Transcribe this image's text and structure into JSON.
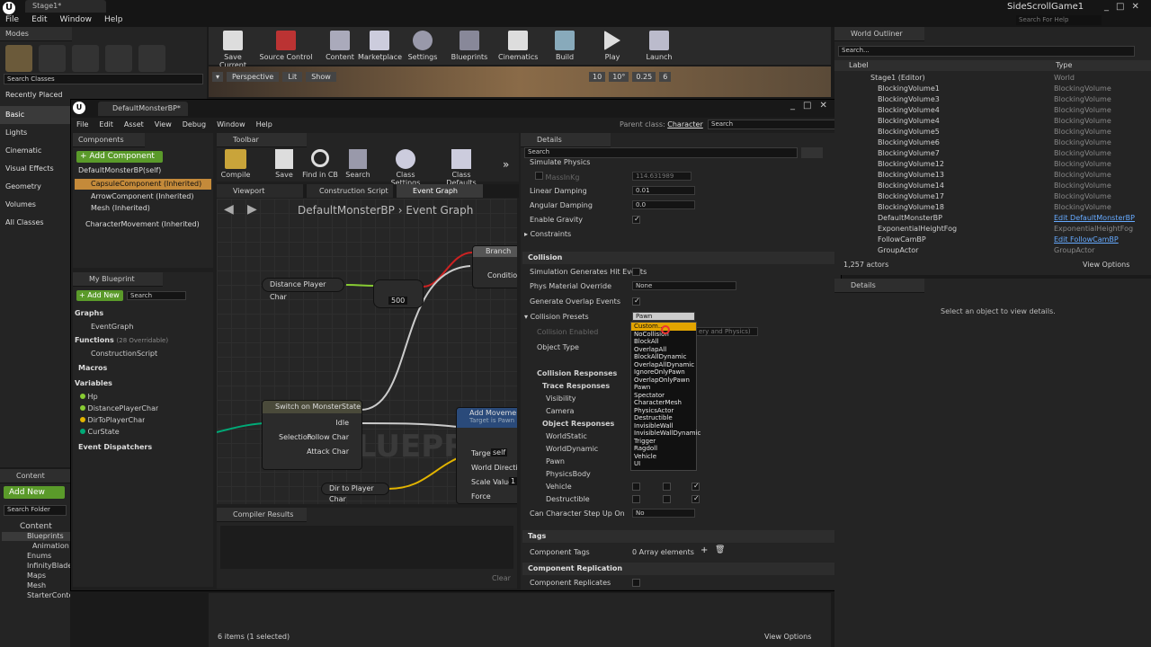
{
  "menubar": {
    "items": [
      "File",
      "Edit",
      "Window",
      "Help"
    ],
    "tab": "Stage1*",
    "project": "SideScrollGame1",
    "search_placeholder": "Search For Help"
  },
  "modes": {
    "title": "Modes",
    "search": "Search Classes",
    "categories": [
      "Recently Placed",
      "Basic",
      "Lights",
      "Cinematic",
      "Visual Effects",
      "Geometry",
      "Volumes",
      "All Classes"
    ]
  },
  "toolbar": {
    "buttons": [
      "Save Current",
      "Source Control",
      "Content",
      "Marketplace",
      "Settings",
      "Blueprints",
      "Cinematics",
      "Build",
      "Play",
      "Launch"
    ]
  },
  "viewport": {
    "perspective": "Perspective",
    "lit": "Lit",
    "show": "Show",
    "grid": "10",
    "angle": "10°",
    "scale": "0.25",
    "cams": "6"
  },
  "bp": {
    "tab": "DefaultMonsterBP*",
    "menu": [
      "File",
      "Edit",
      "Asset",
      "View",
      "Debug",
      "Window",
      "Help"
    ],
    "parent_label": "Parent class:",
    "parent": "Character",
    "search": "Search",
    "components_title": "Components",
    "add_component": "+ Add Component",
    "components": [
      "DefaultMonsterBP(self)",
      "CapsuleComponent (Inherited)",
      "ArrowComponent (Inherited)",
      "Mesh (Inherited)",
      "CharacterMovement (Inherited)"
    ],
    "toolbar_title": "Toolbar",
    "tb": [
      "Compile",
      "Save",
      "Find in CB",
      "Search",
      "Class Settings",
      "Class Defaults"
    ],
    "tabs": [
      "Viewport",
      "Construction Script",
      "Event Graph"
    ],
    "breadcrumb": [
      "DefaultMonsterBP",
      "Event Graph"
    ],
    "my_blueprint": "My Blueprint",
    "add_new": "+ Add New",
    "graphs": "Graphs",
    "event_graph": "EventGraph",
    "functions": "Functions",
    "functions_count": "(28 Overridable)",
    "construction": "ConstructionScript",
    "macros": "Macros",
    "variables": "Variables",
    "vars": [
      "Hp",
      "DistancePlayerChar",
      "DirToPlayerChar",
      "CurState"
    ],
    "dispatchers": "Event Dispatchers",
    "compiler": "Compiler Results",
    "clear": "Clear",
    "watermark": "BLUEPRINT",
    "nodes": {
      "distance": "Distance Player Char",
      "value": "500",
      "branch": "Branch",
      "condition": "Condition",
      "switch": "Switch on MonsterState",
      "idle": "Idle",
      "selection": "Selection",
      "follow": "Follow Char",
      "attack": "Attack Char",
      "add_move": "Add Movement",
      "target_self": "Target is Pawn",
      "target": "Target",
      "self": "self",
      "world_dir": "World Direction",
      "scale": "Scale Value",
      "scale_val": "1",
      "force": "Force",
      "dir_player": "Dir to Player Char"
    }
  },
  "details": {
    "title": "Details",
    "search": "Search",
    "rows": [
      {
        "label": "Simulate Physics"
      },
      {
        "label": "MassInKg",
        "value": "114.631989"
      },
      {
        "label": "Linear Damping",
        "value": "0.01"
      },
      {
        "label": "Angular Damping",
        "value": "0.0"
      },
      {
        "label": "Enable Gravity"
      },
      {
        "label": "Constraints"
      }
    ],
    "collision": "Collision",
    "sim_hit": "Simulation Generates Hit Events",
    "phys_mat": "Phys Material Override",
    "phys_val": "None",
    "overlap": "Generate Overlap Events",
    "presets": "Collision Presets",
    "preset_val": "Pawn",
    "coll_enabled": "Collision Enabled",
    "coll_val": "ery and Physics)",
    "object_type": "Object Type",
    "responses": "Collision Responses",
    "trace": "Trace Responses",
    "trace_rows": [
      "Visibility",
      "Camera"
    ],
    "object_responses": "Object Responses",
    "object_rows": [
      "WorldStatic",
      "WorldDynamic",
      "Pawn",
      "PhysicsBody",
      "Vehicle",
      "Destructible"
    ],
    "step_up": "Can Character Step Up On",
    "step_val": "No",
    "tags": "Tags",
    "comp_tags": "Component Tags",
    "array": "0 Array elements",
    "replication": "Component Replication",
    "replicates": "Component Replicates",
    "dropdown": [
      "Custom...",
      "NoCollision",
      "BlockAll",
      "OverlapAll",
      "BlockAllDynamic",
      "OverlapAllDynamic",
      "IgnoreOnlyPawn",
      "OverlapOnlyPawn",
      "Pawn",
      "Spectator",
      "CharacterMesh",
      "PhysicsActor",
      "Destructible",
      "InvisibleWall",
      "InvisibleWallDynamic",
      "Trigger",
      "Ragdoll",
      "Vehicle",
      "UI"
    ]
  },
  "outliner": {
    "title": "World Outliner",
    "search": "Search...",
    "col_label": "Label",
    "col_type": "Type",
    "rows": [
      {
        "label": "Stage1 (Editor)",
        "type": "World"
      },
      {
        "label": "BlockingVolume1",
        "type": "BlockingVolume"
      },
      {
        "label": "BlockingVolume3",
        "type": "BlockingVolume"
      },
      {
        "label": "BlockingVolume4",
        "type": "BlockingVolume"
      },
      {
        "label": "BlockingVolume4",
        "type": "BlockingVolume"
      },
      {
        "label": "BlockingVolume5",
        "type": "BlockingVolume"
      },
      {
        "label": "BlockingVolume6",
        "type": "BlockingVolume"
      },
      {
        "label": "BlockingVolume7",
        "type": "BlockingVolume"
      },
      {
        "label": "BlockingVolume12",
        "type": "BlockingVolume"
      },
      {
        "label": "BlockingVolume13",
        "type": "BlockingVolume"
      },
      {
        "label": "BlockingVolume14",
        "type": "BlockingVolume"
      },
      {
        "label": "BlockingVolume17",
        "type": "BlockingVolume"
      },
      {
        "label": "BlockingVolume18",
        "type": "BlockingVolume"
      },
      {
        "label": "DefaultMonsterBP",
        "type": "Edit DefaultMonsterBP"
      },
      {
        "label": "ExponentialHeightFog",
        "type": "ExponentialHeightFog"
      },
      {
        "label": "FollowCamBP",
        "type": "Edit FollowCamBP"
      },
      {
        "label": "GroupActor",
        "type": "GroupActor"
      }
    ],
    "actors": "1,257 actors",
    "view_options": "View Options"
  },
  "details2": {
    "title": "Details",
    "empty": "Select an object to view details."
  },
  "content": {
    "title": "Content Browse",
    "add_new": "Add New",
    "search": "Search Folder",
    "tree": [
      "Content",
      "Blueprints",
      "Animation",
      "Enums",
      "InfinityBlade",
      "Maps",
      "Mesh",
      "StarterContent"
    ],
    "status": "6 items (1 selected)",
    "view_options": "View Options"
  }
}
